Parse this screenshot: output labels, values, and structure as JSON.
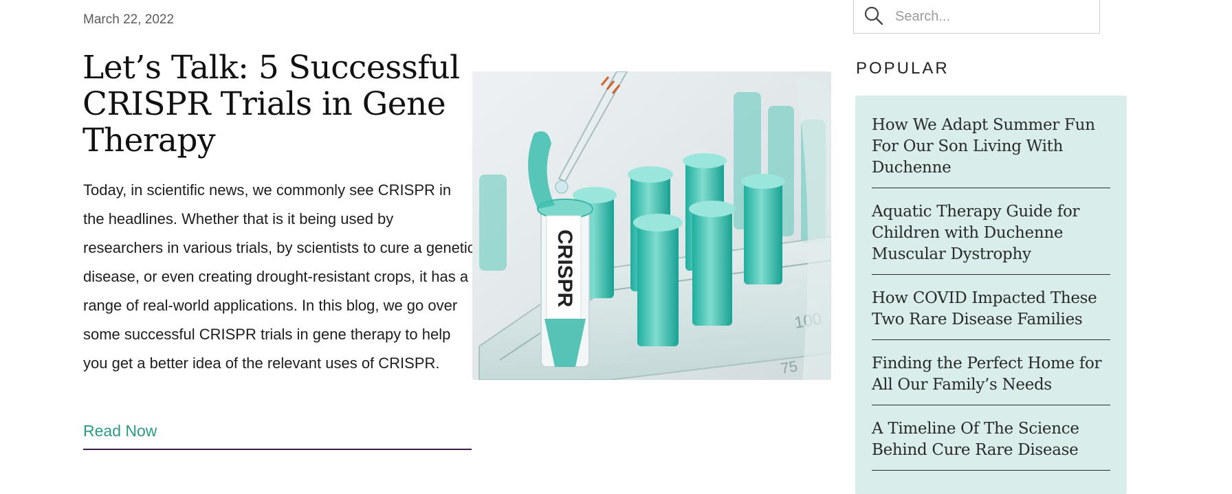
{
  "post": {
    "date": "March 22, 2022",
    "title": "Let’s Talk: 5 Successful CRISPR Trials in Gene Therapy",
    "excerpt": "Today, in scientific news, we commonly see CRISPR in the headlines. Whether that is it being used by researchers in various trials, by scientists to cure a genetic disease, or even creating drought-resistant crops, it has a range of real-world applications. In this blog, we go over some successful CRISPR trials in gene therapy to help you get a better idea of the relevant uses of CRISPR.",
    "read_more": "Read Now",
    "image": {
      "tube_label": "CRISPR",
      "scale_marks": [
        "100",
        "75"
      ]
    }
  },
  "sidebar": {
    "search": {
      "placeholder": "Search...",
      "icon": "search-icon"
    },
    "popular_heading": "POPULAR",
    "popular": [
      "How We Adapt Summer Fun For Our Son Living With Duchenne",
      "Aquatic Therapy Guide for Children with Duchenne Muscular Dystrophy",
      "How COVID Impacted These Two Rare Disease Families",
      "Finding the Perfect Home for All Our Family’s Needs",
      "A Timeline Of The Science Behind Cure Rare Disease"
    ]
  },
  "colors": {
    "accent_link": "#2a9a87",
    "link_underline": "#3d1f4a",
    "popular_background": "#d9eeeb"
  }
}
